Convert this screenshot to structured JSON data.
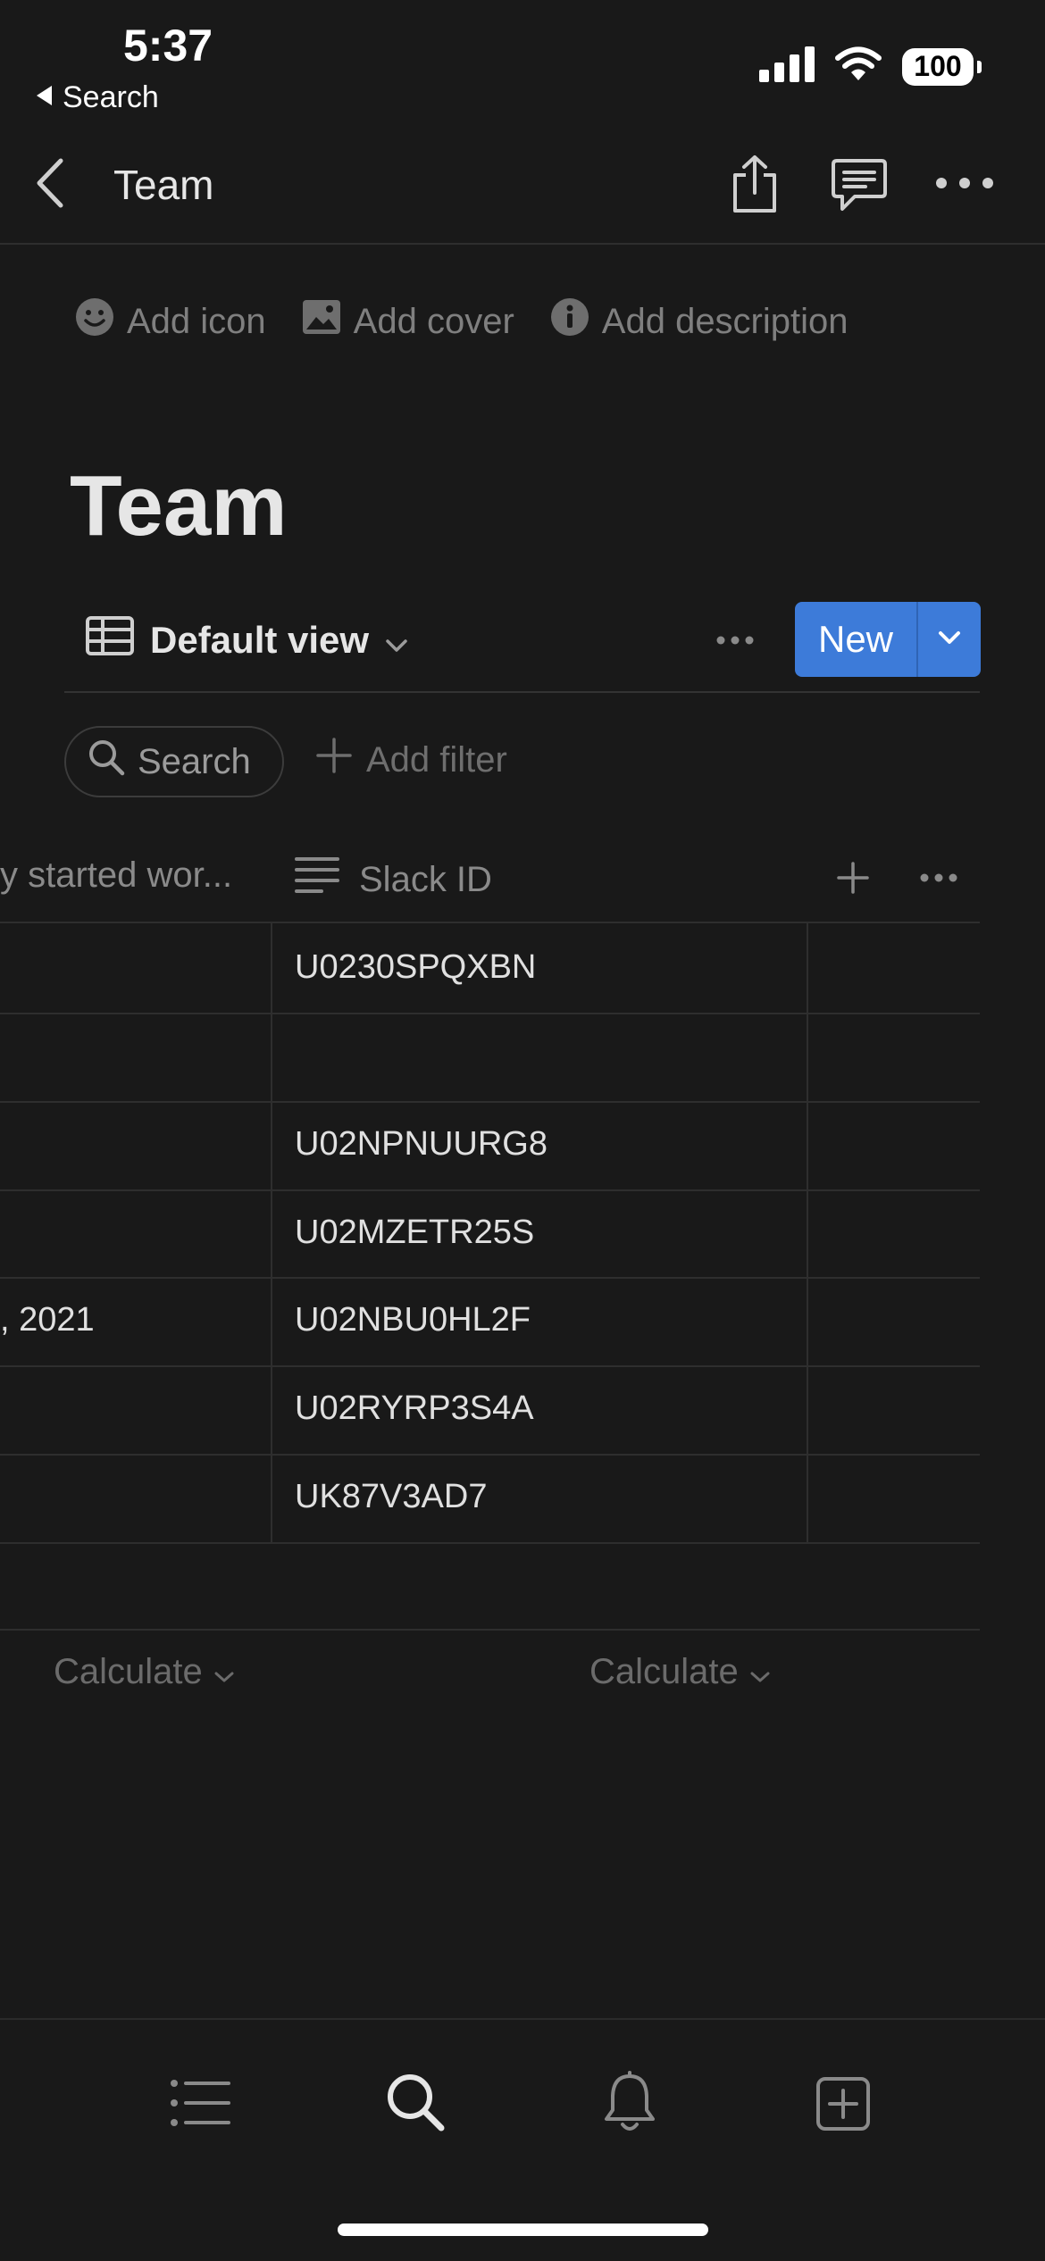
{
  "status_bar": {
    "time": "5:37",
    "back_label": "Search",
    "battery": "100"
  },
  "nav": {
    "title": "Team"
  },
  "page_actions": {
    "add_icon": "Add icon",
    "add_cover": "Add cover",
    "add_description": "Add description"
  },
  "page": {
    "title": "Team"
  },
  "view": {
    "name": "Default view",
    "new_label": "New"
  },
  "toolbar": {
    "search_label": "Search",
    "add_filter_label": "Add filter"
  },
  "table": {
    "columns": {
      "left": "y started wor...",
      "slack": "Slack ID"
    },
    "rows": [
      {
        "left": "",
        "slack": "U0230SPQXBN"
      },
      {
        "left": "",
        "slack": ""
      },
      {
        "left": "",
        "slack": "U02NPNUURG8"
      },
      {
        "left": "",
        "slack": "U02MZETR25S"
      },
      {
        "left": ", 2021",
        "slack": "U02NBU0HL2F"
      },
      {
        "left": "",
        "slack": "U02RYRP3S4A"
      },
      {
        "left": "",
        "slack": "UK87V3AD7"
      }
    ],
    "calculate_left": "Calculate",
    "calculate_right": "Calculate"
  },
  "tab_bar": {
    "icons": [
      "list-icon",
      "search-icon",
      "bell-icon",
      "new-page-icon"
    ]
  },
  "colors": {
    "background": "#191919",
    "accent": "#3d7bd9"
  }
}
